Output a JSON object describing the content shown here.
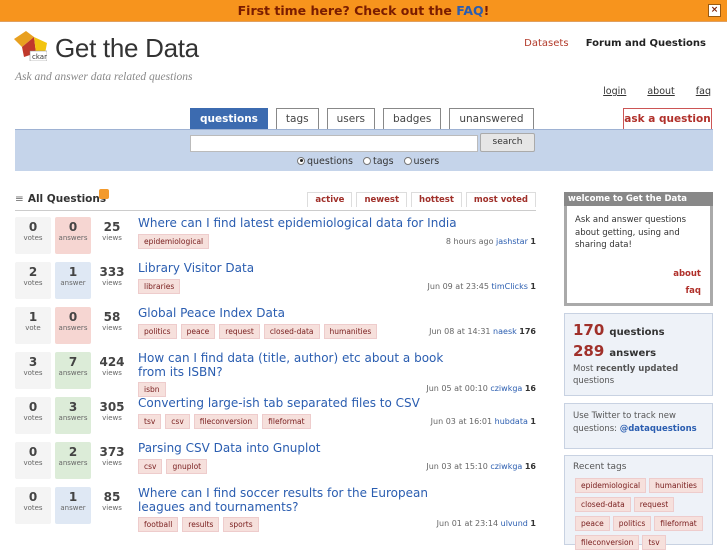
{
  "notify": {
    "text": "First time here? Check out the ",
    "faq": "FAQ",
    "suffix": "!",
    "close": "×"
  },
  "site": {
    "title": "Get the Data",
    "tagline": "Ask and answer data related questions",
    "logo_text": "ckan"
  },
  "top_nav": {
    "datasets": "Datasets",
    "forum": "Forum and Questions"
  },
  "meta_links": [
    "login",
    "about",
    "faq"
  ],
  "tabs": [
    "questions",
    "tags",
    "users",
    "badges",
    "unanswered"
  ],
  "ask_button": "ask a question",
  "search": {
    "button": "search",
    "scopes": [
      "questions",
      "tags",
      "users"
    ],
    "selected": "questions"
  },
  "list": {
    "title": "All Questions",
    "sorts": [
      "active",
      "newest",
      "hottest",
      "most voted"
    ],
    "active_sort": "active"
  },
  "questions": [
    {
      "votes": "0",
      "votes_label": "votes",
      "answers": "0",
      "answers_label": "answers",
      "views": "25",
      "views_label": "views",
      "title": "Where can I find latest epidemiological data for India",
      "tags": [
        "epidemiological"
      ],
      "time": "8 hours ago",
      "user": "jashstar",
      "rep": "1"
    },
    {
      "votes": "2",
      "votes_label": "votes",
      "answers": "1",
      "answers_label": "answer",
      "views": "333",
      "views_label": "views",
      "title": "Library Visitor Data",
      "tags": [
        "libraries"
      ],
      "time": "Jun 09 at 23:45",
      "user": "timClicks",
      "rep": "1"
    },
    {
      "votes": "1",
      "votes_label": "vote",
      "answers": "0",
      "answers_label": "answers",
      "views": "58",
      "views_label": "views",
      "title": "Global Peace Index Data",
      "tags": [
        "politics",
        "peace",
        "request",
        "closed-data",
        "humanities"
      ],
      "time": "Jun 08 at 14:31",
      "user": "naesk",
      "rep": "176"
    },
    {
      "votes": "3",
      "votes_label": "votes",
      "answers": "7",
      "answers_label": "answers",
      "views": "424",
      "views_label": "views",
      "title": "How can I find data (title, author) etc about a book from its ISBN?",
      "tags": [
        "isbn"
      ],
      "time": "Jun 05 at 00:10",
      "user": "cziwkga",
      "rep": "16"
    },
    {
      "votes": "0",
      "votes_label": "votes",
      "answers": "3",
      "answers_label": "answers",
      "views": "305",
      "views_label": "views",
      "title": "Converting large-ish tab separated files to CSV",
      "tags": [
        "tsv",
        "csv",
        "fileconversion",
        "fileformat"
      ],
      "time": "Jun 03 at 16:01",
      "user": "hubdata",
      "rep": "1"
    },
    {
      "votes": "0",
      "votes_label": "votes",
      "answers": "2",
      "answers_label": "answers",
      "views": "373",
      "views_label": "views",
      "title": "Parsing CSV Data into Gnuplot",
      "tags": [
        "csv",
        "gnuplot"
      ],
      "time": "Jun 03 at 15:10",
      "user": "cziwkga",
      "rep": "16"
    },
    {
      "votes": "0",
      "votes_label": "votes",
      "answers": "1",
      "answers_label": "answer",
      "views": "85",
      "views_label": "views",
      "title": "Where can I find soccer results for the European leagues and tournaments?",
      "tags": [
        "football",
        "results",
        "sports"
      ],
      "time": "Jun 01 at 23:14",
      "user": "ulvund",
      "rep": "1"
    }
  ],
  "sidebar": {
    "welcome": {
      "title": "welcome to Get the Data",
      "body": "Ask and answer questions about getting, using and sharing data!",
      "about": "about",
      "faq": "faq"
    },
    "stats": {
      "questions": "170",
      "questions_label": "questions",
      "answers": "289",
      "answers_label": "answers",
      "note_prefix": "Most ",
      "note_bold": "recently updated",
      "note_suffix": " questions"
    },
    "twitter": {
      "text": "Use Twitter to track new questions: ",
      "handle": "@dataquestions"
    },
    "recent": {
      "title": "Recent tags",
      "tags": [
        "epidemiological",
        "humanities",
        "closed-data",
        "request",
        "peace",
        "politics",
        "fileformat",
        "fileconversion",
        "tsv"
      ]
    }
  },
  "colors": {
    "notify_bg": "#f7941d",
    "accent_blue": "#3c6bb0",
    "accent_red": "#b0302a",
    "search_bg": "#c5d4ea"
  }
}
